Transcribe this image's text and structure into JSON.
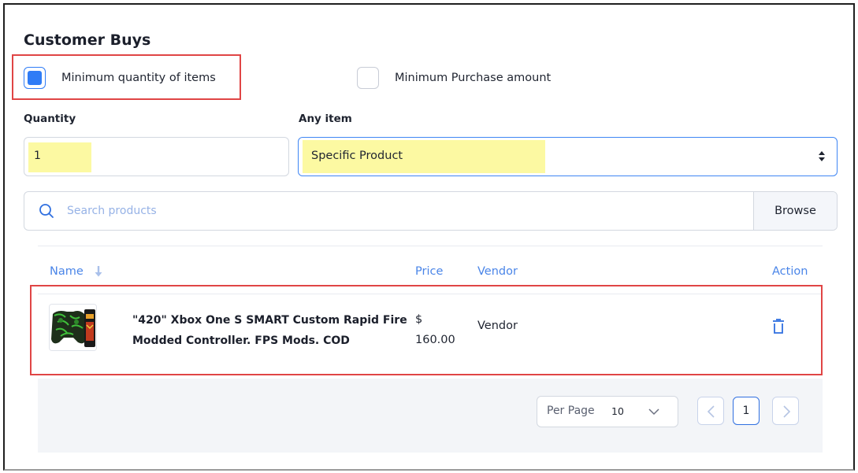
{
  "section": {
    "title": "Customer Buys"
  },
  "options": [
    {
      "label": "Minimum quantity of items",
      "checked": true
    },
    {
      "label": "Minimum Purchase amount",
      "checked": false
    }
  ],
  "quantity": {
    "label": "Quantity",
    "value": "1"
  },
  "any_item": {
    "label": "Any item",
    "selected": "Specific Product"
  },
  "search": {
    "placeholder": "Search products",
    "browse_label": "Browse"
  },
  "table": {
    "columns": {
      "name": "Name",
      "price": "Price",
      "vendor": "Vendor",
      "action": "Action"
    },
    "rows": [
      {
        "name": "\"420\" Xbox One S SMART Custom Rapid Fire Modded Controller. FPS Mods. COD",
        "price_symbol": "$",
        "price_value": "160.00",
        "vendor": "Vendor"
      }
    ]
  },
  "pagination": {
    "per_page_label": "Per Page",
    "per_page_value": "10",
    "current_page": "1"
  },
  "colors": {
    "accent": "#2f7cf6",
    "header_text": "#4a85e8",
    "highlight": "#fcf9a2",
    "annotation": "#e04545"
  },
  "icons": {
    "search": "search-icon",
    "sort": "arrow-down-icon",
    "delete": "trash-icon",
    "prev": "chevron-left-icon",
    "next": "chevron-right-icon",
    "dropdown": "chevron-down-icon"
  }
}
